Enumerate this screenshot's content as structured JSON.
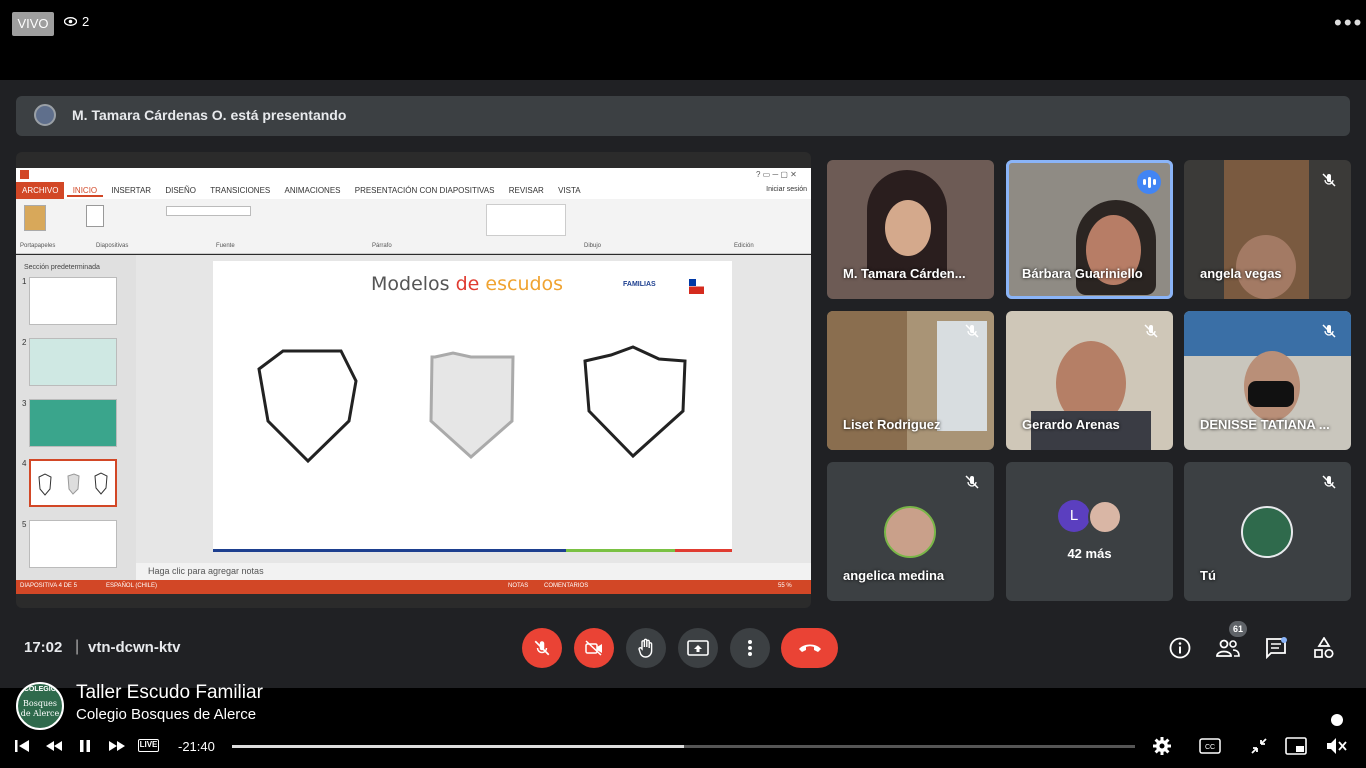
{
  "stream": {
    "live_badge": "VIVO",
    "viewer_count": "2"
  },
  "meet": {
    "presenter_banner": "M. Tamara Cárdenas O. está presentando",
    "clock": "17:02",
    "separator": "|",
    "meeting_code": "vtn-dcwn-ktv",
    "participant_count": "61",
    "participants": [
      {
        "name": "M. Tamara Cárden...",
        "muted": false,
        "speaking": false
      },
      {
        "name": "Bárbara Guariniello",
        "muted": false,
        "speaking": true
      },
      {
        "name": "angela vegas",
        "muted": true,
        "speaking": false
      },
      {
        "name": "Liset Rodriguez",
        "muted": true,
        "speaking": false
      },
      {
        "name": "Gerardo Arenas",
        "muted": true,
        "speaking": false
      },
      {
        "name": "DENISSE TATIANA ...",
        "muted": true,
        "speaking": false
      },
      {
        "name": "angelica medina",
        "muted": true,
        "speaking": false
      },
      {
        "name": "42 más",
        "muted": false,
        "speaking": false
      },
      {
        "name": "Tú",
        "muted": true,
        "speaking": false
      }
    ],
    "more_avatar_letter": "L"
  },
  "ppt": {
    "tabs": [
      "ARCHIVO",
      "INICIO",
      "INSERTAR",
      "DISEÑO",
      "TRANSICIONES",
      "ANIMACIONES",
      "PRESENTACIÓN CON DIAPOSITIVAS",
      "REVISAR",
      "VISTA"
    ],
    "signin": "Iniciar sesión",
    "ribbon_groups": [
      "Portapapeles",
      "Diapositivas",
      "Fuente",
      "Párrafo",
      "Dibujo",
      "Edición"
    ],
    "section_label": "Sección predeterminada",
    "thumb_numbers": [
      "1",
      "2",
      "3",
      "4",
      "5"
    ],
    "slide_title_1": "Modelos ",
    "slide_title_2": "de ",
    "slide_title_3": "escudos",
    "slide_logo_text": "FAMILIAS",
    "notes_placeholder": "Haga clic para agregar notas",
    "status_left": "DIAPOSITIVA 4 DE 5",
    "status_lang": "ESPAÑOL (CHILE)",
    "status_notes": "NOTAS",
    "status_comments": "COMENTARIOS",
    "status_zoom": "55 %"
  },
  "player": {
    "title": "Taller Escudo Familiar",
    "channel": "Colegio Bosques de Alerce",
    "live_label": "LIVE",
    "time": "-21:40",
    "progress": 0.5,
    "logo_text_top": "COLEGIO",
    "logo_text_mid": "Bosques",
    "logo_text_bot": "de Alerce"
  },
  "colors": {
    "meet_bg": "#202124",
    "tile_bg": "#3c4043",
    "end_call": "#ea4335",
    "speaking": "#8ab4f8",
    "ppt_accent": "#d24726"
  }
}
